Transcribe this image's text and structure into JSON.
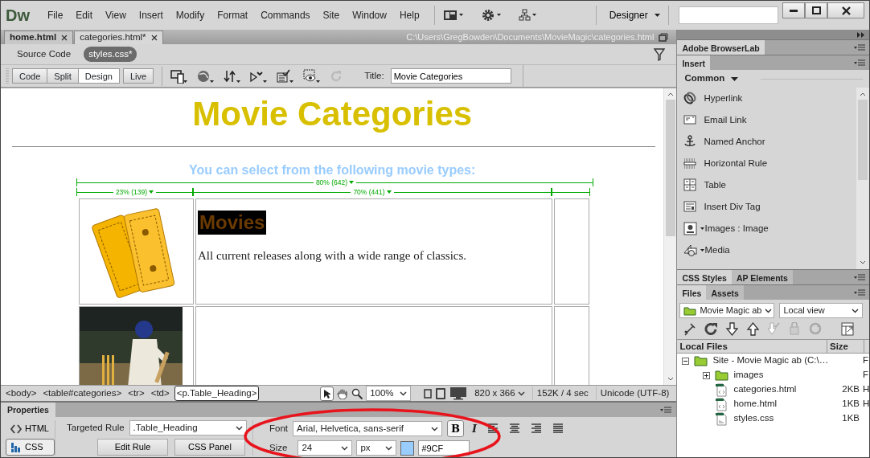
{
  "app": {
    "logo": "Dw",
    "menu": [
      "File",
      "Edit",
      "View",
      "Insert",
      "Modify",
      "Format",
      "Commands",
      "Site",
      "Window",
      "Help"
    ],
    "workspace": "Designer"
  },
  "document_tabs": [
    {
      "label": "home.html",
      "selected": false
    },
    {
      "label": "categories.html*",
      "selected": true
    }
  ],
  "file_path": "C:\\Users\\GregBowden\\Documents\\MovieMagic\\categories.html",
  "related_files": [
    {
      "label": "Source Code",
      "selected": false
    },
    {
      "label": "styles.css*",
      "selected": true
    }
  ],
  "view_buttons": [
    {
      "label": "Code",
      "selected": false
    },
    {
      "label": "Split",
      "selected": false
    },
    {
      "label": "Design",
      "selected": true
    },
    {
      "label": "Live",
      "selected": false
    }
  ],
  "title_field": {
    "label": "Title:",
    "value": "Movie Categories"
  },
  "design_view": {
    "heading": "Movie Categories",
    "subheading": "You can select from the following movie types:",
    "table_width": "80% (642)",
    "column_widths": [
      "23% (139)",
      "70% (441)"
    ],
    "rows": [
      {
        "kind": "text",
        "heading": "Movies",
        "description": "All current releases along with a wide range of classics."
      },
      {
        "kind": "empty"
      }
    ]
  },
  "tag_selector": [
    {
      "label": "<body>",
      "selected": false
    },
    {
      "label": "<table#categories>",
      "selected": false
    },
    {
      "label": "<tr>",
      "selected": false
    },
    {
      "label": "<td>",
      "selected": false
    },
    {
      "label": "<p.Table_Heading>",
      "selected": true
    }
  ],
  "status_bar": {
    "zoom": "100%",
    "window_size": "820 x 366",
    "download": "152K / 4 sec",
    "encoding": "Unicode (UTF-8)"
  },
  "properties": {
    "title": "Properties",
    "modes": [
      {
        "label": "HTML",
        "selected": false
      },
      {
        "label": "CSS",
        "selected": true
      }
    ],
    "targeted_rule": {
      "label": "Targeted Rule",
      "value": ".Table_Heading"
    },
    "buttons": [
      "Edit Rule",
      "CSS Panel"
    ],
    "font": {
      "label": "Font",
      "value": "Arial, Helvetica, sans-serif"
    },
    "bold_button": "B",
    "italic_button": "I",
    "size": {
      "label": "Size",
      "value": "24",
      "unit": "px"
    },
    "text_color": "#9CF"
  },
  "browserlab_tab": "Adobe BrowserLab",
  "insert_panel": {
    "tab": "Insert",
    "category": "Common",
    "items": [
      {
        "label": "Hyperlink",
        "kind": "plain"
      },
      {
        "label": "Email Link",
        "kind": "plain"
      },
      {
        "label": "Named Anchor",
        "kind": "plain"
      },
      {
        "label": "Horizontal Rule",
        "kind": "plain"
      },
      {
        "label": "Table",
        "kind": "plain"
      },
      {
        "label": "Insert Div Tag",
        "kind": "plain"
      },
      {
        "label": "Images : Image",
        "kind": "menu"
      },
      {
        "label": "Media",
        "kind": "menu"
      }
    ]
  },
  "css_tabs": [
    {
      "label": "CSS Styles",
      "selected": true
    },
    {
      "label": "AP Elements",
      "selected": false
    }
  ],
  "files_panel": {
    "tabs": [
      {
        "label": "Files",
        "selected": true
      },
      {
        "label": "Assets",
        "selected": false
      }
    ],
    "site": "Movie Magic ab",
    "view": "Local view",
    "columns": [
      "Local Files",
      "Size"
    ],
    "tree": [
      {
        "name": "Site - Movie Magic ab (C:\\…",
        "kind": "site",
        "expanded": true,
        "column_3": "F",
        "children": [
          {
            "name": "images",
            "kind": "folder",
            "expanded": false,
            "column_3": "F"
          },
          {
            "name": "categories.html",
            "kind": "html",
            "size": "2KB",
            "column_3": "H"
          },
          {
            "name": "home.html",
            "kind": "html",
            "size": "1KB",
            "column_3": "H"
          },
          {
            "name": "styles.css",
            "kind": "css",
            "size": "1KB"
          }
        ]
      }
    ]
  }
}
